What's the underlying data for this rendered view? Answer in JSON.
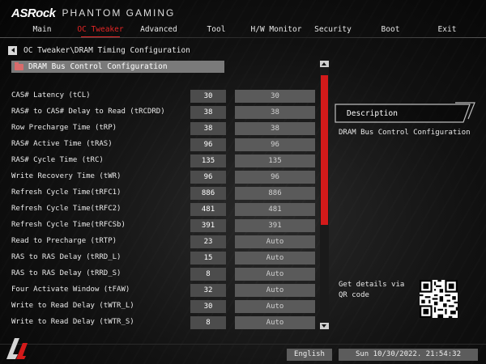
{
  "brand": {
    "logo": "ASRock",
    "sub": "PHANTOM GAMING"
  },
  "nav": [
    {
      "label": "Main",
      "active": false
    },
    {
      "label": "OC Tweaker",
      "active": true
    },
    {
      "label": "Advanced",
      "active": false
    },
    {
      "label": "Tool",
      "active": false
    },
    {
      "label": "H/W Monitor",
      "active": false
    },
    {
      "label": "Security",
      "active": false
    },
    {
      "label": "Boot",
      "active": false
    },
    {
      "label": "Exit",
      "active": false
    }
  ],
  "breadcrumb": "OC Tweaker\\DRAM Timing Configuration",
  "section": "DRAM Bus Control Configuration",
  "rows": [
    {
      "label": "CAS# Latency (tCL)",
      "value": "30",
      "setting": "30"
    },
    {
      "label": "RAS# to CAS# Delay to Read  (tRCDRD)",
      "value": "38",
      "setting": "38"
    },
    {
      "label": "Row Precharge Time (tRP)",
      "value": "38",
      "setting": "38"
    },
    {
      "label": "RAS# Active Time (tRAS)",
      "value": "96",
      "setting": "96"
    },
    {
      "label": "RAS# Cycle Time (tRC)",
      "value": "135",
      "setting": "135"
    },
    {
      "label": "Write Recovery Time (tWR)",
      "value": "96",
      "setting": "96"
    },
    {
      "label": "Refresh Cycle Time(tRFC1)",
      "value": "886",
      "setting": "886"
    },
    {
      "label": "Refresh Cycle Time(tRFC2)",
      "value": "481",
      "setting": "481"
    },
    {
      "label": "Refresh Cycle Time(tRFCSb)",
      "value": "391",
      "setting": "391"
    },
    {
      "label": "Read to Precharge (tRTP)",
      "value": "23",
      "setting": "Auto"
    },
    {
      "label": "RAS to RAS Delay (tRRD_L)",
      "value": "15",
      "setting": "Auto"
    },
    {
      "label": "RAS to RAS Delay (tRRD_S)",
      "value": "8",
      "setting": "Auto"
    },
    {
      "label": "Four Activate Window (tFAW)",
      "value": "32",
      "setting": "Auto"
    },
    {
      "label": "Write to Read Delay (tWTR_L)",
      "value": "30",
      "setting": "Auto"
    },
    {
      "label": "Write to Read Delay (tWTR_S)",
      "value": "8",
      "setting": "Auto"
    }
  ],
  "description": {
    "title": "Description",
    "text": "DRAM Bus Control Configuration",
    "qr_text": "Get details via QR code"
  },
  "footer": {
    "language": "English",
    "datetime": "Sun 10/30/2022. 21:54:32"
  },
  "colors": {
    "accent": "#e32525",
    "scrollbar": "#d31a1a"
  }
}
